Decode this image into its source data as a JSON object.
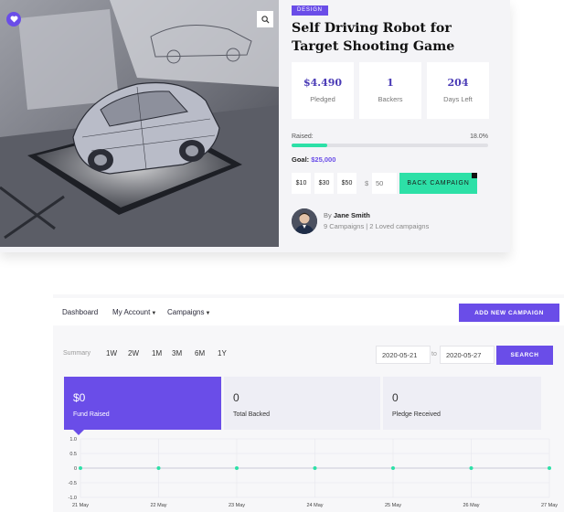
{
  "campaign": {
    "category": "DESIGN",
    "title": "Self Driving Robot for Target Shooting Game",
    "stats": [
      {
        "value": "$4.490",
        "label": "Pledged"
      },
      {
        "value": "1",
        "label": "Backers"
      },
      {
        "value": "204",
        "label": "Days Left"
      }
    ],
    "raised_label": "Raised:",
    "raised_percent_text": "18.0%",
    "raised_fraction": 0.18,
    "goal_label": "Goal:",
    "goal_amount": "$25,000",
    "pledge_amounts": [
      "$10",
      "$30",
      "$50"
    ],
    "currency_symbol": "$",
    "pledge_value": "50",
    "back_button": "BACK CAMPAIGN",
    "author_prefix": "By",
    "author_name": "Jane Smith",
    "author_meta": "9 Campaigns | 2 Loved campaigns",
    "icons": {
      "favorite": "heart-icon",
      "zoom": "magnifier-icon"
    }
  },
  "dashboard": {
    "nav": [
      {
        "label": "Dashboard",
        "dropdown": false
      },
      {
        "label": "My Account",
        "dropdown": true
      },
      {
        "label": "Campaigns",
        "dropdown": true
      }
    ],
    "add_button": "ADD NEW CAMPAIGN",
    "summary_label": "Summary",
    "ranges": [
      "1W",
      "2W",
      "1M",
      "3M",
      "6M",
      "1Y"
    ],
    "date_from": "2020-05-21",
    "to_label": "to",
    "date_to": "2020-05-27",
    "search_button": "SEARCH",
    "kpis": [
      {
        "value": "$0",
        "label": "Fund Raised",
        "active": true
      },
      {
        "value": "0",
        "label": "Total Backed",
        "active": false
      },
      {
        "value": "0",
        "label": "Pledge Received",
        "active": false
      }
    ],
    "accent_color": "#6a4de8",
    "success_color": "#2de0a7"
  },
  "chart_data": {
    "type": "line",
    "x": [
      "21 May",
      "22 May",
      "23 May",
      "24 May",
      "25 May",
      "26 May",
      "27 May"
    ],
    "series": [
      {
        "values": [
          0,
          0,
          0,
          0,
          0,
          0,
          0
        ]
      }
    ],
    "yticks": [
      "1.0",
      "0.5",
      "0",
      "-0.5",
      "-1.0"
    ],
    "ylim": [
      -1.0,
      1.0
    ],
    "grid": true,
    "line_color": "#c8c8d8",
    "marker_color": "#2de0a7"
  }
}
